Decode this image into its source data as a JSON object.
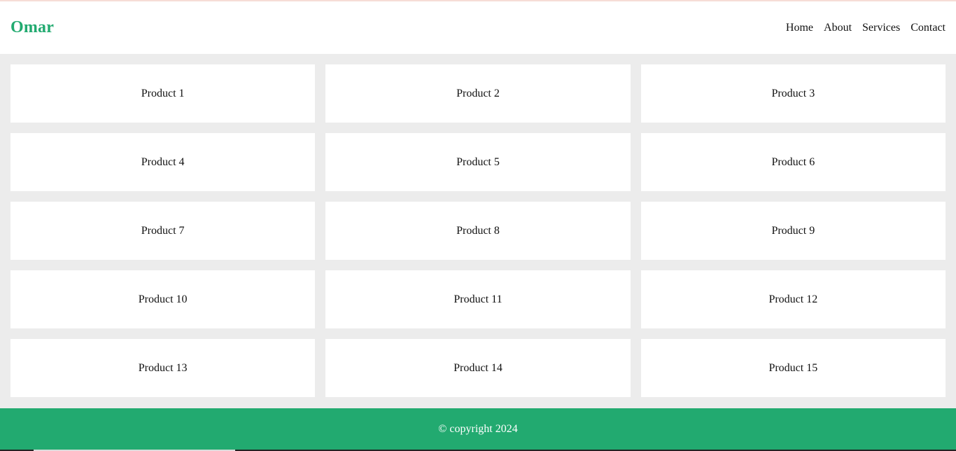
{
  "header": {
    "logo": "Omar",
    "nav": [
      {
        "label": "Home"
      },
      {
        "label": "About"
      },
      {
        "label": "Services"
      },
      {
        "label": "Contact"
      }
    ]
  },
  "products": [
    {
      "label": "Product 1"
    },
    {
      "label": "Product 2"
    },
    {
      "label": "Product 3"
    },
    {
      "label": "Product 4"
    },
    {
      "label": "Product 5"
    },
    {
      "label": "Product 6"
    },
    {
      "label": "Product 7"
    },
    {
      "label": "Product 8"
    },
    {
      "label": "Product 9"
    },
    {
      "label": "Product 10"
    },
    {
      "label": "Product 11"
    },
    {
      "label": "Product 12"
    },
    {
      "label": "Product 13"
    },
    {
      "label": "Product 14"
    },
    {
      "label": "Product 15"
    }
  ],
  "footer": {
    "copyright": "© copyright 2024"
  },
  "colors": {
    "brand": "#22aa70",
    "page_background": "#ececec",
    "card_background": "#ffffff"
  }
}
